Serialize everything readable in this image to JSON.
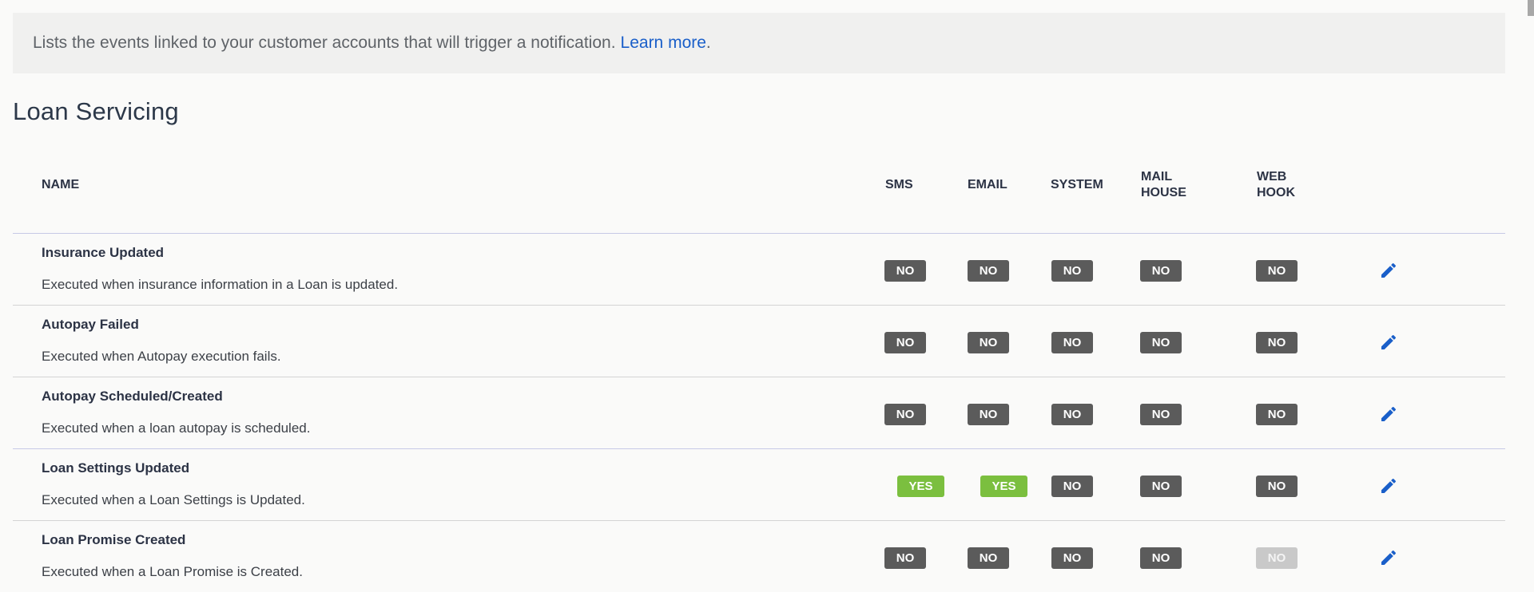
{
  "banner": {
    "text": "Lists the events linked to your customer accounts that will trigger a notification.",
    "link_label": "Learn more",
    "trailing": "."
  },
  "section": {
    "title": "Loan Servicing"
  },
  "table": {
    "headers": {
      "name": "NAME",
      "sms": "SMS",
      "email": "EMAIL",
      "system": "SYSTEM",
      "mail_house_1": "MAIL",
      "mail_house_2": "HOUSE",
      "web_hook_1": "WEB",
      "web_hook_2": "HOOK"
    },
    "rows": [
      {
        "name": "Insurance Updated",
        "description": "Executed when insurance information in a Loan is updated.",
        "sms": "NO",
        "email": "NO",
        "system": "NO",
        "mail_house": "NO",
        "web_hook": "NO"
      },
      {
        "name": "Autopay Failed",
        "description": "Executed when Autopay execution fails.",
        "sms": "NO",
        "email": "NO",
        "system": "NO",
        "mail_house": "NO",
        "web_hook": "NO"
      },
      {
        "name": "Autopay Scheduled/Created",
        "description": "Executed when a loan autopay is scheduled.",
        "sms": "NO",
        "email": "NO",
        "system": "NO",
        "mail_house": "NO",
        "web_hook": "NO"
      },
      {
        "name": "Loan Settings Updated",
        "description": "Executed when a Loan Settings is Updated.",
        "sms": "YES",
        "email": "YES",
        "system": "NO",
        "mail_house": "NO",
        "web_hook": "NO"
      },
      {
        "name": "Loan Promise Created",
        "description": "Executed when a Loan Promise is Created.",
        "sms": "NO",
        "email": "NO",
        "system": "NO",
        "mail_house": "NO",
        "web_hook": "NO"
      }
    ]
  },
  "icons": {
    "edit": "pencil-icon"
  },
  "colors": {
    "badge_no": "#5b5b5b",
    "badge_yes": "#7bbf3f",
    "link": "#1a5fc9",
    "edit_icon": "#1a5fc9"
  }
}
